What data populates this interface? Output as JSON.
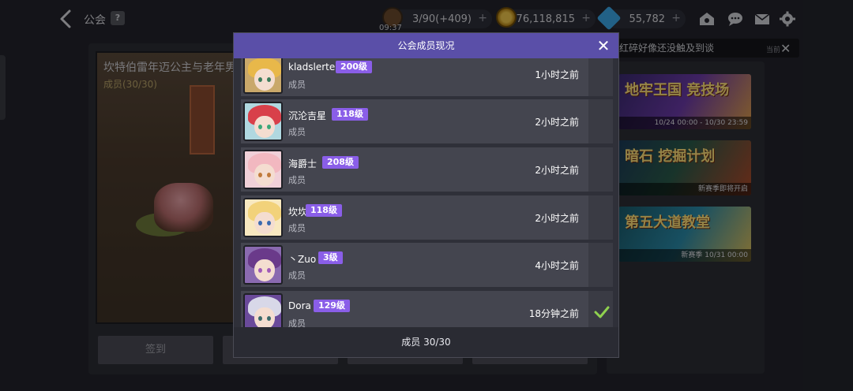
{
  "header": {
    "title": "公会",
    "help": "?",
    "clock": "09:37"
  },
  "resources": {
    "stamina": "3/90(+409)",
    "gold": "176,118,815",
    "gems": "55,782",
    "plus": "+"
  },
  "notice": {
    "text": "红碎好像还没触及到谈",
    "time": "当前",
    "close": "✕"
  },
  "guild": {
    "name": "坎特伯雷年迈公主与老年男",
    "members": "成员(30/30)",
    "actions": [
      "签到",
      "",
      "",
      ""
    ]
  },
  "events": [
    {
      "title": "地牢王国 竞技场",
      "footer": "10/24 00:00 - 10/30 23:59"
    },
    {
      "title": "暗石 挖掘计划",
      "footer": "新赛季即将开启"
    },
    {
      "title": "第五大道教堂",
      "footer": "新赛季 10/31 00:00"
    }
  ],
  "modal": {
    "title": "公会成员现况",
    "close": "✕",
    "footer": "成员 30/30",
    "members": [
      {
        "name": "kladslerte",
        "level": "200级",
        "role": "成员",
        "time": "1小时之前",
        "hair": "#e8b84a",
        "eye": "#3a7a5a",
        "bg": "#c9a86a"
      },
      {
        "name": "沉沦吉星",
        "level": "118级",
        "role": "成员",
        "time": "2小时之前",
        "hair": "#d8404a",
        "eye": "#3aa87a",
        "bg": "#b0d8e0"
      },
      {
        "name": "海爵士",
        "level": "208级",
        "role": "成员",
        "time": "2小时之前",
        "hair": "#f2b8c0",
        "eye": "#c07a3a",
        "bg": "#f0d0d8"
      },
      {
        "name": "坎坎坎",
        "level": "118级",
        "role": "成员",
        "time": "2小时之前",
        "hair": "#f2d27a",
        "eye": "#3a6ab0",
        "bg": "#f8e8c0"
      },
      {
        "name": "丶Zuo",
        "level": "3级",
        "role": "成员",
        "time": "4小时之前",
        "hair": "#6a3a8a",
        "eye": "#a05ab8",
        "bg": "#8a6ab0"
      },
      {
        "name": "Dora",
        "level": "129级",
        "role": "成员",
        "time": "18分钟之前",
        "hair": "#d8d8e8",
        "eye": "#3a6a6a",
        "bg": "#6a4a9a"
      }
    ]
  },
  "colors": {
    "modal_header": "#5a4fa8",
    "level_badge": "#8a5ee8",
    "online_check": "#8fd14f"
  }
}
